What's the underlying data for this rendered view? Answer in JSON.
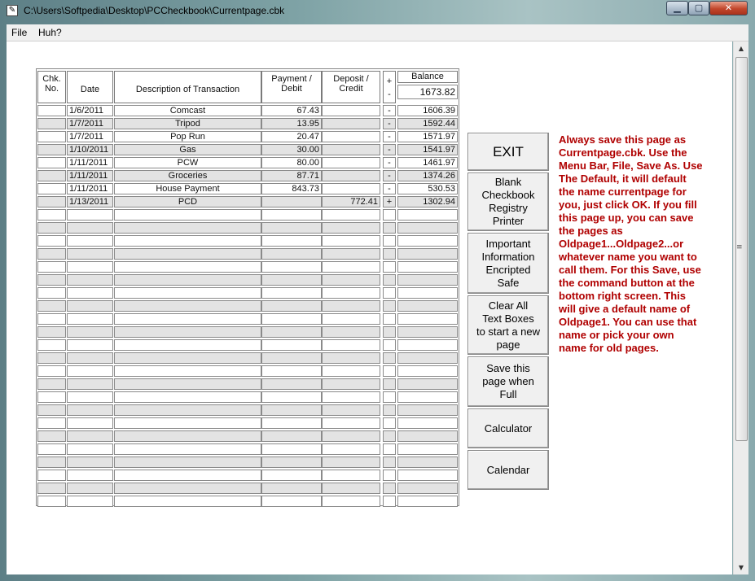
{
  "window": {
    "title": "C:\\Users\\Softpedia\\Desktop\\PCCheckbook\\Currentpage.cbk"
  },
  "menu": [
    "File",
    "Huh?"
  ],
  "headers": {
    "chk": [
      "Chk.",
      "No."
    ],
    "date": "Date",
    "desc": "Description of Transaction",
    "payment": [
      "Payment /",
      "Debit"
    ],
    "deposit": [
      "Deposit /",
      "Credit"
    ],
    "sign": [
      "+",
      "-"
    ],
    "balance": "Balance",
    "start_balance": "1673.82"
  },
  "rows": [
    {
      "chk": "",
      "date": "1/6/2011",
      "desc": "Comcast",
      "payment": "67.43",
      "deposit": "",
      "sign": "-",
      "balance": "1606.39"
    },
    {
      "chk": "",
      "date": "1/7/2011",
      "desc": "Tripod",
      "payment": "13.95",
      "deposit": "",
      "sign": "-",
      "balance": "1592.44"
    },
    {
      "chk": "",
      "date": "1/7/2011",
      "desc": "Pop Run",
      "payment": "20.47",
      "deposit": "",
      "sign": "-",
      "balance": "1571.97"
    },
    {
      "chk": "",
      "date": "1/10/2011",
      "desc": "Gas",
      "payment": "30.00",
      "deposit": "",
      "sign": "-",
      "balance": "1541.97"
    },
    {
      "chk": "",
      "date": "1/11/2011",
      "desc": "PCW",
      "payment": "80.00",
      "deposit": "",
      "sign": "-",
      "balance": "1461.97"
    },
    {
      "chk": "",
      "date": "1/11/2011",
      "desc": "Groceries",
      "payment": "87.71",
      "deposit": "",
      "sign": "-",
      "balance": "1374.26"
    },
    {
      "chk": "",
      "date": "1/11/2011",
      "desc": "House Payment",
      "payment": "843.73",
      "deposit": "",
      "sign": "-",
      "balance": "530.53"
    },
    {
      "chk": "",
      "date": "1/13/2011",
      "desc": "PCD",
      "payment": "",
      "deposit": "772.41",
      "sign": "+",
      "balance": "1302.94"
    }
  ],
  "buttons": {
    "exit": "EXIT",
    "printer": [
      "Blank",
      "Checkbook",
      "Registry",
      "Printer"
    ],
    "safe": [
      "Important",
      "Information",
      "Encripted",
      "Safe"
    ],
    "clear": [
      "Clear All",
      "Text Boxes",
      "to start a new",
      "page"
    ],
    "save": [
      "Save this",
      "page when",
      "Full"
    ],
    "calculator": "Calculator",
    "calendar": "Calendar"
  },
  "note": "Always save this page as Currentpage.cbk. Use the Menu Bar, File, Save As. Use The Default, it will default the name currentpage for you, just click OK. If you fill this page up, you can save the pages as Oldpage1...Oldpage2...or whatever name you want to call them. For this Save, use the command button at the bottom right screen. This will give a default name of Oldpage1. You can use that name or pick your own name for old pages."
}
